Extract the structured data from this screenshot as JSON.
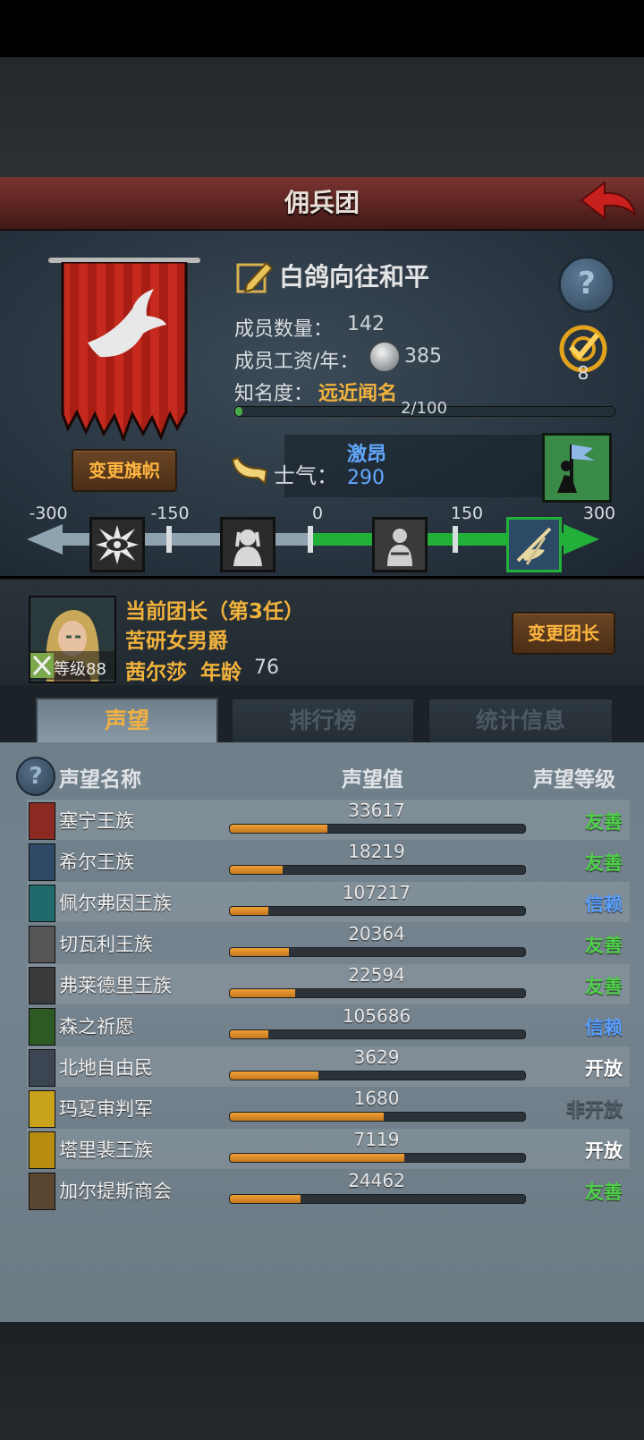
{
  "header": {
    "title": "佣兵团",
    "back_icon": "back-arrow-icon"
  },
  "company": {
    "name": "白鸽向往和平",
    "members_label": "成员数量：",
    "members_value": "142",
    "wage_label": "成员工资/年：",
    "wage_value": "385",
    "fame_label": "知名度：",
    "fame_value": "远近闻名",
    "fame_progress_text": "2/100",
    "fame_progress": 0.02,
    "target_count": "8",
    "change_banner_label": "变更旗帜"
  },
  "morale": {
    "label": "士气：",
    "state": "激昂",
    "value": "290",
    "scale_ticks": [
      "-300",
      "-150",
      "0",
      "150",
      "300"
    ],
    "range": [
      -300,
      300
    ]
  },
  "leader": {
    "title_line": "当前团长（第3任）",
    "trait": "苦研女男爵",
    "level_label": "等级88",
    "name": "茜尔莎",
    "age_label": "年龄",
    "age_value": "76",
    "change_leader_label": "变更团长"
  },
  "tabs": [
    {
      "label": "声望",
      "active": true
    },
    {
      "label": "排行榜",
      "active": false
    },
    {
      "label": "统计信息",
      "active": false
    }
  ],
  "table": {
    "headers": {
      "name": "声望名称",
      "value": "声望值",
      "level": "声望等级"
    },
    "rows": [
      {
        "name": "塞宁王族",
        "value": "33617",
        "progress": 0.33,
        "level": "友善",
        "level_color": "#4fd04a",
        "icon_color": "#8a2a20"
      },
      {
        "name": "希尔王族",
        "value": "18219",
        "progress": 0.18,
        "level": "友善",
        "level_color": "#4fd04a",
        "icon_color": "#2f4a66"
      },
      {
        "name": "佩尔弗因王族",
        "value": "107217",
        "progress": 0.13,
        "level": "信赖",
        "level_color": "#5aa0ff",
        "icon_color": "#1f6a6a"
      },
      {
        "name": "切瓦利王族",
        "value": "20364",
        "progress": 0.2,
        "level": "友善",
        "level_color": "#4fd04a",
        "icon_color": "#555555"
      },
      {
        "name": "弗莱德里王族",
        "value": "22594",
        "progress": 0.22,
        "level": "友善",
        "level_color": "#4fd04a",
        "icon_color": "#3a3a3a"
      },
      {
        "name": "森之祈愿",
        "value": "105686",
        "progress": 0.13,
        "level": "信赖",
        "level_color": "#5aa0ff",
        "icon_color": "#2d5a22"
      },
      {
        "name": "北地自由民",
        "value": "3629",
        "progress": 0.3,
        "level": "开放",
        "level_color": "#ffffff",
        "icon_color": "#3b4652"
      },
      {
        "name": "玛夏审判军",
        "value": "1680",
        "progress": 0.52,
        "level": "非开放",
        "level_color": "#4e5a66",
        "icon_color": "#c8a21a"
      },
      {
        "name": "塔里裴王族",
        "value": "7119",
        "progress": 0.59,
        "level": "开放",
        "level_color": "#ffffff",
        "icon_color": "#b88c10"
      },
      {
        "name": "加尔提斯商会",
        "value": "24462",
        "progress": 0.24,
        "level": "友善",
        "level_color": "#4fd04a",
        "icon_color": "#5a4630"
      }
    ]
  }
}
